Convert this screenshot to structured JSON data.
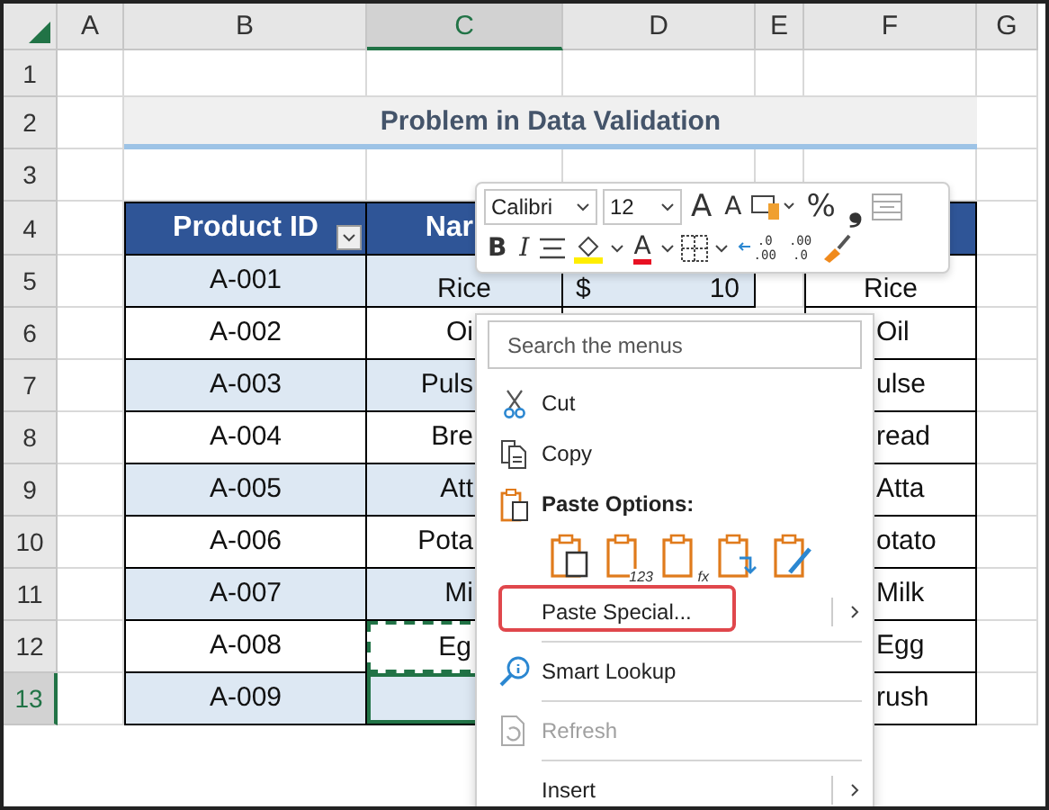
{
  "columns": [
    {
      "label": "A",
      "selected": false
    },
    {
      "label": "B",
      "selected": false
    },
    {
      "label": "C",
      "selected": true
    },
    {
      "label": "D",
      "selected": false
    },
    {
      "label": "E",
      "selected": false
    },
    {
      "label": "F",
      "selected": false
    },
    {
      "label": "G",
      "selected": false
    }
  ],
  "row_headers": [
    {
      "label": "1",
      "selected": false
    },
    {
      "label": "2",
      "selected": false
    },
    {
      "label": "3",
      "selected": false
    },
    {
      "label": "4",
      "selected": false
    },
    {
      "label": "5",
      "selected": false
    },
    {
      "label": "6",
      "selected": false
    },
    {
      "label": "7",
      "selected": false
    },
    {
      "label": "8",
      "selected": false
    },
    {
      "label": "9",
      "selected": false
    },
    {
      "label": "10",
      "selected": false
    },
    {
      "label": "11",
      "selected": false
    },
    {
      "label": "12",
      "selected": false
    },
    {
      "label": "13",
      "selected": true
    }
  ],
  "title": "Problem in Data Validation",
  "table": {
    "headers": [
      {
        "text": "Product ID",
        "filter": true
      },
      {
        "text": "Nar",
        "filter": false
      }
    ],
    "rows": [
      {
        "id": "A-001",
        "name": "Rice",
        "currency": "$",
        "price": "10",
        "copy": "Rice",
        "marquee": false,
        "selected": false
      },
      {
        "id": "A-002",
        "name": "Oi",
        "copy": "Oil",
        "marquee": false,
        "selected": false
      },
      {
        "id": "A-003",
        "name": "Puls",
        "copy": "ulse",
        "marquee": false,
        "selected": false
      },
      {
        "id": "A-004",
        "name": "Bre",
        "copy": "read",
        "marquee": false,
        "selected": false
      },
      {
        "id": "A-005",
        "name": "Att",
        "copy": "Atta",
        "marquee": false,
        "selected": false
      },
      {
        "id": "A-006",
        "name": "Pota",
        "copy": "otato",
        "marquee": false,
        "selected": false
      },
      {
        "id": "A-007",
        "name": "Mi",
        "copy": "Milk",
        "marquee": false,
        "selected": false
      },
      {
        "id": "A-008",
        "name": "Eg",
        "copy": "Egg",
        "marquee": true,
        "selected": false
      },
      {
        "id": "A-009",
        "copy": "rush",
        "marquee": false,
        "selected": true
      }
    ]
  },
  "mini_toolbar": {
    "font": "Calibri",
    "size": "12",
    "grow_font": "A",
    "shrink_font": "A",
    "percent": "%",
    "comma": "❟",
    "bold": "B",
    "italic": "I",
    "font_color": "A",
    "increase_decimal": [
      ".0",
      ".00"
    ],
    "decrease_decimal": [
      ".00",
      ".0"
    ]
  },
  "context_menu": {
    "search": {
      "placeholder": "Search the menus"
    },
    "items": [
      {
        "kind": "cut",
        "label": "Cut",
        "disabled": false,
        "submenu": false,
        "highlighted": false
      },
      {
        "kind": "copy",
        "label": "Copy",
        "disabled": false,
        "submenu": false,
        "highlighted": false
      },
      {
        "kind": "paste_header",
        "label": "Paste Options:"
      },
      {
        "kind": "paste_options",
        "options": [
          {
            "kind": "paste"
          },
          {
            "kind": "values",
            "badge": "123"
          },
          {
            "kind": "formulas",
            "badge": "fx"
          },
          {
            "kind": "transpose"
          },
          {
            "kind": "formatting"
          }
        ]
      },
      {
        "kind": "paste_special",
        "label": "Paste Special...",
        "disabled": false,
        "submenu": true,
        "highlighted": true
      },
      {
        "kind": "separator"
      },
      {
        "kind": "smart_lookup",
        "label": "Smart Lookup",
        "disabled": false,
        "submenu": false,
        "highlighted": false
      },
      {
        "kind": "separator"
      },
      {
        "kind": "refresh",
        "label": "Refresh",
        "disabled": true,
        "submenu": false,
        "highlighted": false
      },
      {
        "kind": "separator"
      },
      {
        "kind": "insert",
        "label": "Insert",
        "disabled": false,
        "submenu": true,
        "highlighted": false
      }
    ]
  }
}
